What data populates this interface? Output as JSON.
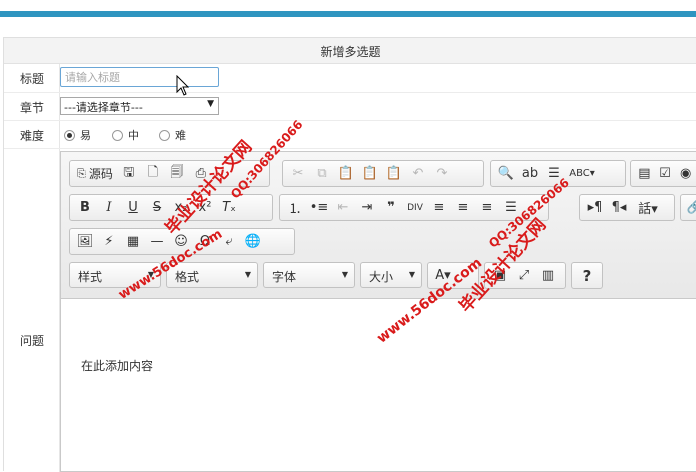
{
  "form": {
    "title": "新增多选题",
    "labels": {
      "title": "标题",
      "chapter": "章节",
      "difficulty": "难度",
      "question": "问题"
    },
    "title_input": {
      "placeholder": "请输入标题",
      "value": ""
    },
    "chapter_select": {
      "selected": "---请选择章节---"
    },
    "difficulty_options": [
      {
        "label": "易",
        "checked": true
      },
      {
        "label": "中",
        "checked": false
      },
      {
        "label": "难",
        "checked": false
      }
    ]
  },
  "editor": {
    "source_label": "源码",
    "combos": {
      "styles": "样式",
      "format": "格式",
      "font": "字体",
      "size": "大小"
    },
    "placeholder_content": "在此添加内容"
  },
  "watermark": {
    "site_title": "毕业设计论文网",
    "url": "www.56doc.com",
    "qq": "QQ:306826066"
  },
  "colors": {
    "accent_bar": "#2f95c0",
    "watermark": "#d91b1b"
  }
}
